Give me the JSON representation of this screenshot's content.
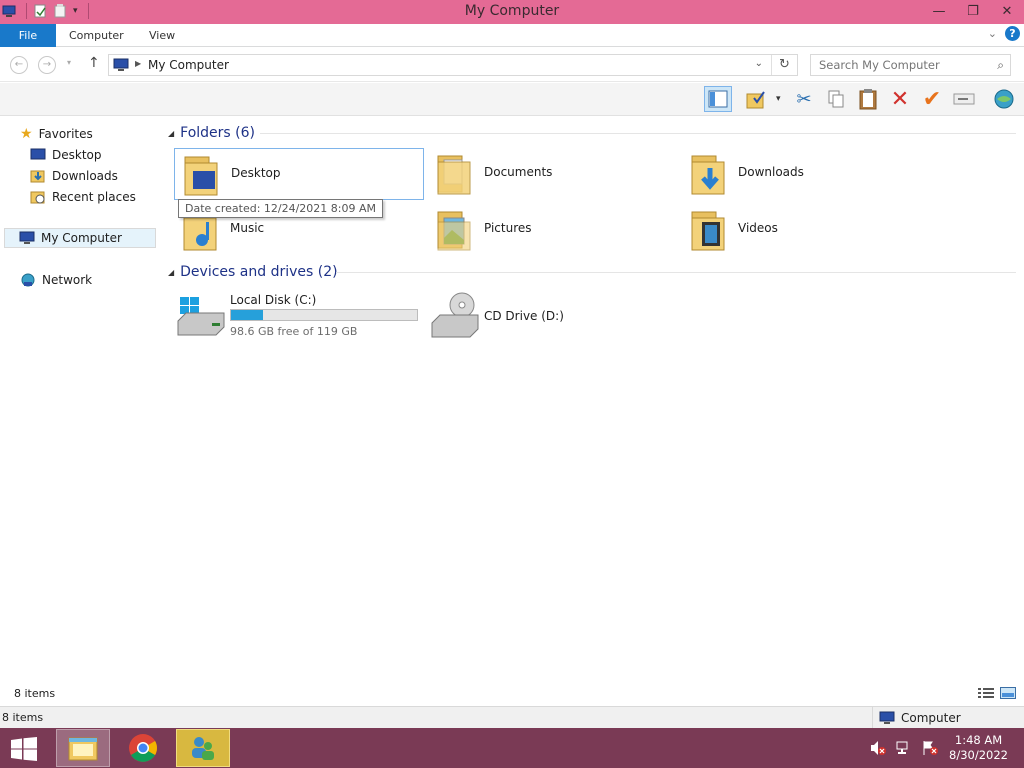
{
  "window": {
    "title": "My Computer"
  },
  "ribbon": {
    "tabs": [
      "File",
      "Computer",
      "View"
    ]
  },
  "address": {
    "path": "My Computer",
    "search_placeholder": "Search My Computer"
  },
  "nav": {
    "favorites_label": "Favorites",
    "favorites": [
      "Desktop",
      "Downloads",
      "Recent places"
    ],
    "computer_label": "My Computer",
    "network_label": "Network"
  },
  "folders": {
    "header": "Folders (6)",
    "items": [
      "Desktop",
      "Documents",
      "Downloads",
      "Music",
      "Pictures",
      "Videos"
    ],
    "tooltip": "Date created: 12/24/2021 8:09 AM"
  },
  "drives": {
    "header": "Devices and drives (2)",
    "items": [
      {
        "name": "Local Disk (C:)",
        "free_text": "98.6 GB free of 119 GB",
        "used_fraction": 0.17
      },
      {
        "name": "CD Drive (D:)"
      }
    ]
  },
  "status": {
    "items_text": "8 items",
    "items_text2": "8 items",
    "location": "Computer"
  },
  "taskbar": {
    "time": "1:48 AM",
    "date": "8/30/2022"
  },
  "colors": {
    "title_bar": "#e46a95",
    "file_tab": "#1979ca",
    "taskbar": "#7a3a55",
    "folder_header": "#1e3287",
    "drive_bar": "#26a0da"
  }
}
